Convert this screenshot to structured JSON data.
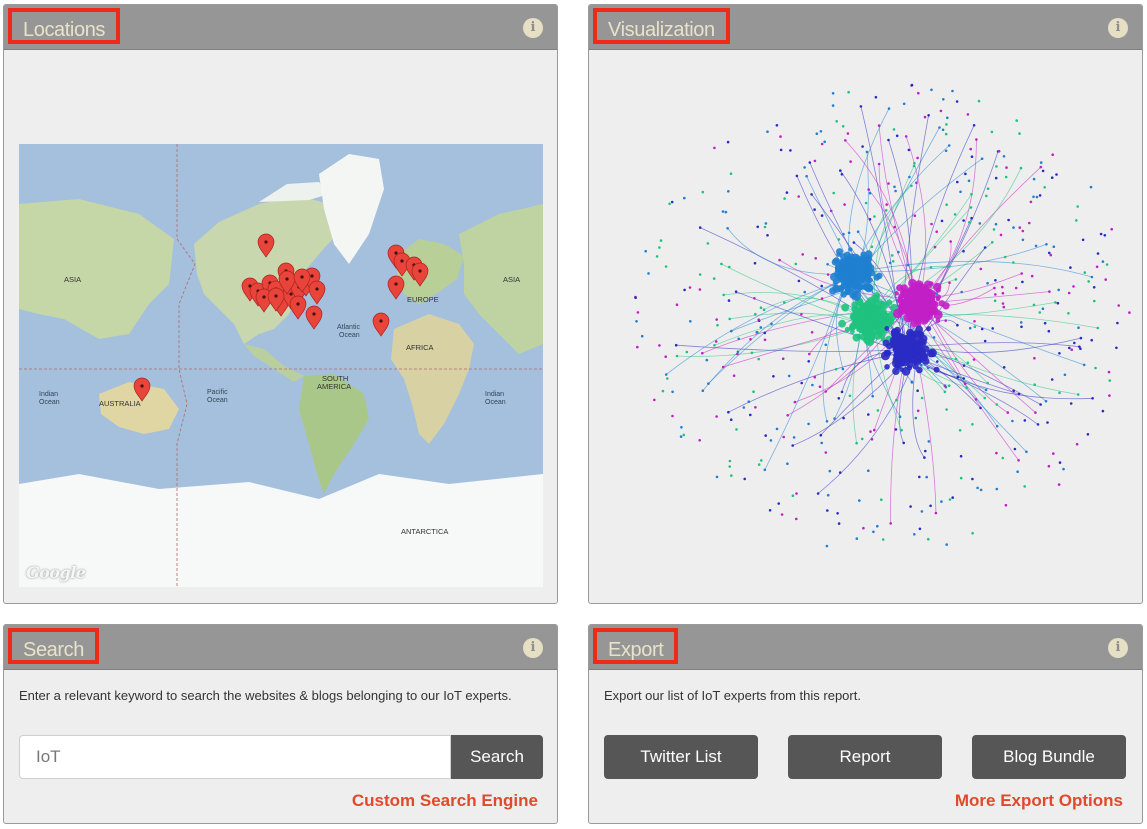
{
  "locations": {
    "title": "Locations",
    "map_labels": {
      "asia_left": "ASIA",
      "asia_right": "ASIA",
      "europe": "EUROPE",
      "africa": "AFRICA",
      "atlantic": "Atlantic",
      "atlantic2": "Ocean",
      "south_america": "SOUTH",
      "south_america2": "AMERICA",
      "pacific": "Pacific",
      "pacific2": "Ocean",
      "indian_left": "Indian",
      "indian_left2": "Ocean",
      "indian_right": "Indian",
      "indian_right2": "Ocean",
      "australia": "AUSTRALIA",
      "antarctica": "ANTARCTICA"
    },
    "google_label": "Google",
    "marker_color": "#e8443a"
  },
  "visualization": {
    "title": "Visualization",
    "colors": [
      "#1fc27e",
      "#c21fc6",
      "#2a2ac4",
      "#1f7fd0"
    ]
  },
  "search": {
    "title": "Search",
    "description": "Enter a relevant keyword to search the websites & blogs belonging to our IoT experts.",
    "input_value": "IoT",
    "button_label": "Search",
    "link_label": "Custom Search Engine"
  },
  "export": {
    "title": "Export",
    "description": "Export our list of IoT experts from this report.",
    "buttons": [
      "Twitter List",
      "Report",
      "Blog Bundle"
    ],
    "link_label": "More Export Options"
  },
  "accent_color": "#e04a2c"
}
